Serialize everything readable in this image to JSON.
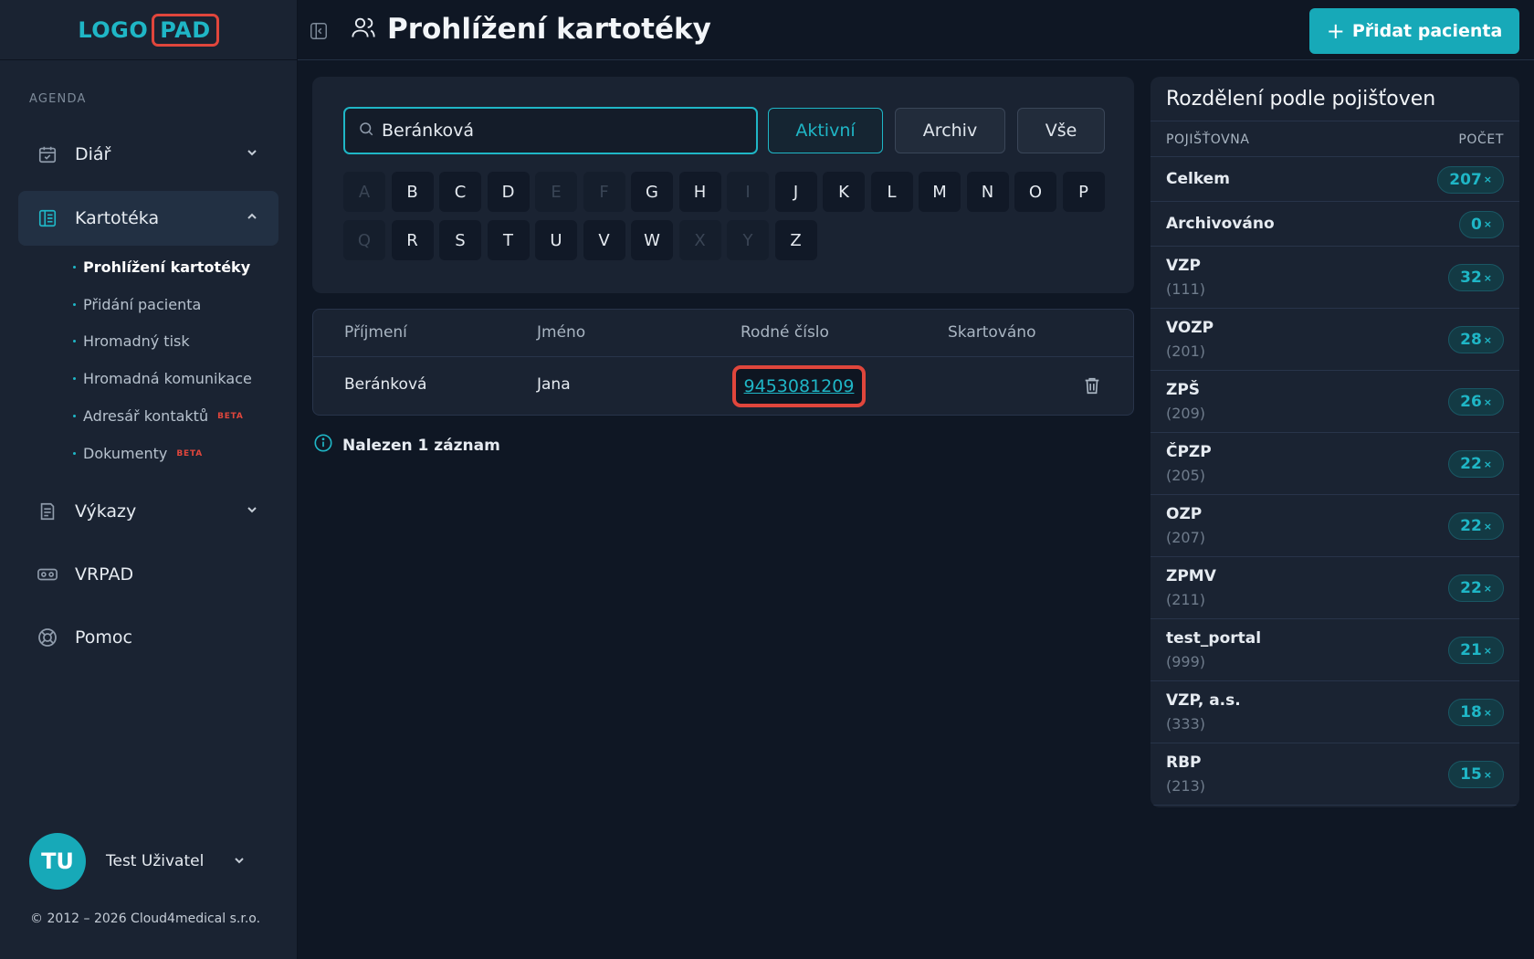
{
  "logo": {
    "part1": "LOGO",
    "part2": "PAD"
  },
  "sidebar": {
    "section_label": "AGENDA",
    "items": [
      {
        "label": "Diář"
      },
      {
        "label": "Kartotéka"
      },
      {
        "label": "Výkazy"
      },
      {
        "label": "VRPAD"
      },
      {
        "label": "Pomoc"
      }
    ],
    "subitems": [
      {
        "label": "Prohlížení kartotéky"
      },
      {
        "label": "Přidání pacienta"
      },
      {
        "label": "Hromadný tisk"
      },
      {
        "label": "Hromadná komunikace"
      },
      {
        "label": "Adresář kontaktů",
        "badge": "BETA"
      },
      {
        "label": "Dokumenty",
        "badge": "BETA"
      }
    ],
    "user": {
      "initials": "TU",
      "name": "Test Uživatel"
    },
    "copyright": "© 2012 – 2026 Cloud4medical s.r.o."
  },
  "header": {
    "title": "Prohlížení kartotéky",
    "add_button": "Přidat pacienta"
  },
  "filter": {
    "search_value": "Beránková",
    "buttons": [
      "Aktivní",
      "Archiv",
      "Vše"
    ],
    "letters_row1": [
      "A",
      "B",
      "C",
      "D",
      "E",
      "F",
      "G",
      "H",
      "I",
      "J",
      "K",
      "L",
      "M",
      "N",
      "O",
      "P"
    ],
    "letters_row2": [
      "Q",
      "R",
      "S",
      "T",
      "U",
      "V",
      "W",
      "X",
      "Y",
      "Z"
    ],
    "disabled_letters": [
      "A",
      "E",
      "F",
      "I",
      "Q",
      "X",
      "Y"
    ]
  },
  "table": {
    "columns": [
      "Příjmení",
      "Jméno",
      "Rodné číslo",
      "Skartováno"
    ],
    "rows": [
      {
        "prijmeni": "Beránková",
        "jmeno": "Jana",
        "rodne_cislo": "9453081209",
        "skartovano": ""
      }
    ],
    "found_text": "Nalezen 1 záznam"
  },
  "insurance": {
    "title": "Rozdělení podle pojišťoven",
    "col_name": "POJIŠŤOVNA",
    "col_count": "POČET",
    "rows": [
      {
        "name": "Celkem",
        "code": "",
        "count": "207"
      },
      {
        "name": "Archivováno",
        "code": "",
        "count": "0"
      },
      {
        "name": "VZP",
        "code": "(111)",
        "count": "32"
      },
      {
        "name": "VOZP",
        "code": "(201)",
        "count": "28"
      },
      {
        "name": "ZPŠ",
        "code": "(209)",
        "count": "26"
      },
      {
        "name": "ČPZP",
        "code": "(205)",
        "count": "22"
      },
      {
        "name": "OZP",
        "code": "(207)",
        "count": "22"
      },
      {
        "name": "ZPMV",
        "code": "(211)",
        "count": "22"
      },
      {
        "name": "test_portal",
        "code": "(999)",
        "count": "21"
      },
      {
        "name": "VZP, a.s.",
        "code": "(333)",
        "count": "18"
      },
      {
        "name": "RBP",
        "code": "(213)",
        "count": "15"
      }
    ],
    "count_suffix": "×"
  },
  "colors": {
    "accent": "#1fb6c6",
    "highlight": "#e0463c",
    "background": "#0f1724",
    "panel": "#1a2332"
  }
}
